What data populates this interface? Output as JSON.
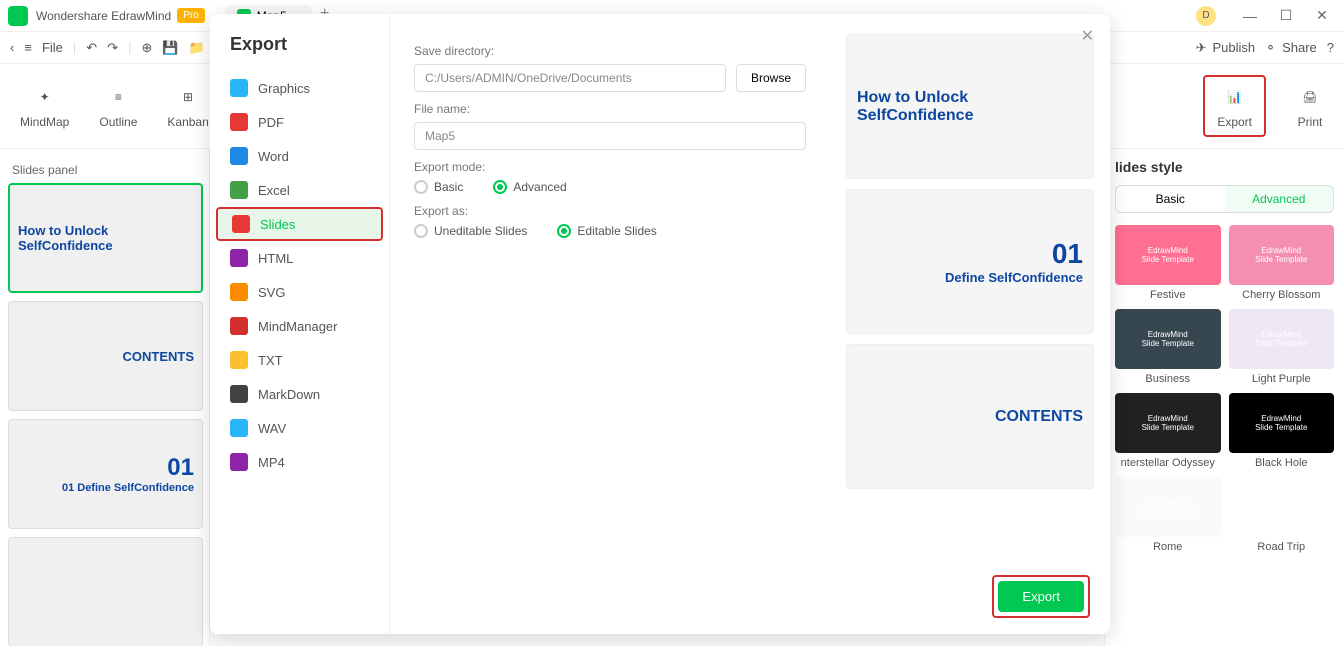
{
  "app": {
    "name": "Wondershare EdrawMind",
    "badge": "Pro",
    "tab_name": "Map5",
    "avatar": "D"
  },
  "toolbar": {
    "file": "File",
    "publish": "Publish",
    "share": "Share"
  },
  "ribbon": {
    "mindmap": "MindMap",
    "outline": "Outline",
    "kanban": "Kanban",
    "export": "Export",
    "print": "Print"
  },
  "slides_panel": {
    "title": "Slides panel",
    "slides": [
      {
        "title": "How to Unlock SelfConfidence"
      },
      {
        "title": "CONTENTS"
      },
      {
        "title": "01 Define SelfConfidence"
      },
      {
        "title": ""
      }
    ]
  },
  "right_panel": {
    "title": "lides style",
    "tab_basic": "Basic",
    "tab_advanced": "Advanced",
    "styles": [
      {
        "name": "Festive",
        "bg": "#ff6f91"
      },
      {
        "name": "Cherry Blossom",
        "bg": "#f48fb1"
      },
      {
        "name": "Business",
        "bg": "#37474f"
      },
      {
        "name": "Light Purple",
        "bg": "#ede7f6"
      },
      {
        "name": "nterstellar Odyssey",
        "bg": "#212121"
      },
      {
        "name": "Black Hole",
        "bg": "#000000"
      },
      {
        "name": "Rome",
        "bg": "#fafafa"
      },
      {
        "name": "Road Trip",
        "bg": "#ffffff"
      }
    ]
  },
  "modal": {
    "title": "Export",
    "formats": [
      {
        "label": "Graphics",
        "color": "#29b6f6"
      },
      {
        "label": "PDF",
        "color": "#e53935"
      },
      {
        "label": "Word",
        "color": "#1e88e5"
      },
      {
        "label": "Excel",
        "color": "#43a047"
      },
      {
        "label": "Slides",
        "color": "#e53935"
      },
      {
        "label": "HTML",
        "color": "#8e24aa"
      },
      {
        "label": "SVG",
        "color": "#fb8c00"
      },
      {
        "label": "MindManager",
        "color": "#d32f2f"
      },
      {
        "label": "TXT",
        "color": "#fbc02d"
      },
      {
        "label": "MarkDown",
        "color": "#424242"
      },
      {
        "label": "WAV",
        "color": "#29b6f6"
      },
      {
        "label": "MP4",
        "color": "#8e24aa"
      }
    ],
    "save_dir_label": "Save directory:",
    "save_dir_value": "C:/Users/ADMIN/OneDrive/Documents",
    "browse": "Browse",
    "file_name_label": "File name:",
    "file_name_value": "Map5",
    "export_mode_label": "Export mode:",
    "mode_basic": "Basic",
    "mode_advanced": "Advanced",
    "export_as_label": "Export as:",
    "as_uneditable": "Uneditable Slides",
    "as_editable": "Editable Slides",
    "export_btn": "Export",
    "preview": [
      {
        "title": "How to Unlock SelfConfidence",
        "num": ""
      },
      {
        "title": "Define SelfConfidence",
        "num": "01"
      },
      {
        "title": "CONTENTS",
        "num": ""
      }
    ]
  }
}
